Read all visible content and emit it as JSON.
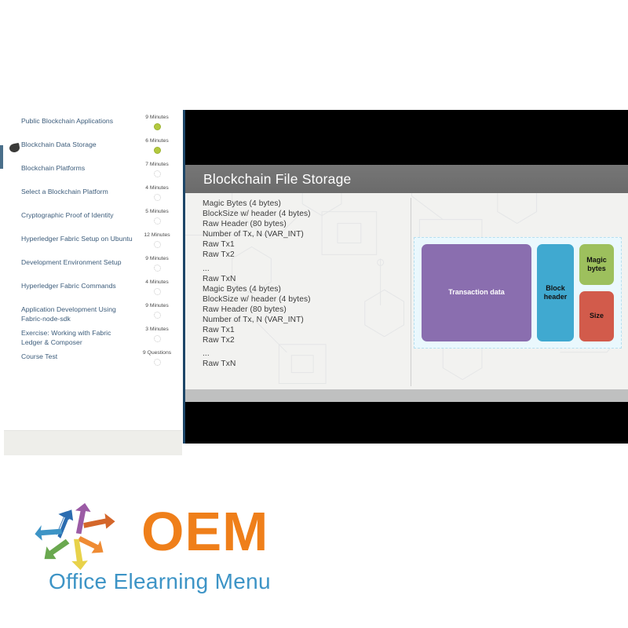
{
  "player": {
    "sidebar": {
      "lessons": [
        {
          "title": "Public Blockchain Applications",
          "duration": "9 Minutes",
          "status": "done"
        },
        {
          "title": "Blockchain Data Storage",
          "duration": "6 Minutes",
          "status": "done",
          "active": true
        },
        {
          "title": "Blockchain Platforms",
          "duration": "7 Minutes",
          "status": "todo"
        },
        {
          "title": "Select a Blockchain Platform",
          "duration": "4 Minutes",
          "status": "todo"
        },
        {
          "title": "Cryptographic Proof of Identity",
          "duration": "5 Minutes",
          "status": "todo"
        },
        {
          "title": "Hyperledger Fabric Setup on Ubuntu",
          "duration": "12 Minutes",
          "status": "todo"
        },
        {
          "title": "Development Environment Setup",
          "duration": "9 Minutes",
          "status": "todo"
        },
        {
          "title": "Hyperledger Fabric Commands",
          "duration": "4 Minutes",
          "status": "todo"
        },
        {
          "title": "Application Development Using Fabric-node-sdk",
          "duration": "9 Minutes",
          "status": "todo"
        },
        {
          "title": "Exercise: Working with Fabric Ledger & Composer",
          "duration": "3 Minutes",
          "status": "todo"
        },
        {
          "title": "Course Test",
          "duration": "9 Questions",
          "status": "todo"
        }
      ]
    },
    "slide": {
      "title": "Blockchain File Storage",
      "code_lines": [
        "Magic Bytes (4 bytes)",
        "BlockSize w/ header (4 bytes)",
        "Raw Header (80 bytes)",
        "Number of Tx, N (VAR_INT)",
        "Raw Tx1",
        "Raw Tx2",
        "",
        "...",
        "Raw TxN",
        "Magic Bytes (4 bytes)",
        "BlockSize w/ header (4 bytes)",
        "Raw Header (80 bytes)",
        "Number of Tx, N (VAR_INT)",
        "Raw Tx1",
        "Raw Tx2",
        "",
        "...",
        "Raw TxN"
      ],
      "diagram": {
        "transaction_data": "Transaction data",
        "block_header": "Block header",
        "magic_bytes": "Magic bytes",
        "size": "Size",
        "colors": {
          "transaction_data": "#8a6eaf",
          "block_header": "#40a9d0",
          "magic_bytes": "#9dc05d",
          "size": "#d25b4b",
          "panel_background": "#eaf8fd"
        }
      }
    }
  },
  "logo": {
    "wordmark": "OEM",
    "tagline": "Office Elearning Menu",
    "colors": {
      "wordmark": "#ef7f1a",
      "tagline": "#3d94c6"
    },
    "arrows": [
      {
        "name": "arrow-up-left-blue",
        "color": "#2b6cb0"
      },
      {
        "name": "arrow-up-purple",
        "color": "#9b5ba5"
      },
      {
        "name": "arrow-right-orange",
        "color": "#d4662a"
      },
      {
        "name": "arrow-down-right-orange",
        "color": "#ef8b33"
      },
      {
        "name": "arrow-down-yellow",
        "color": "#e8d24a"
      },
      {
        "name": "arrow-down-left-green",
        "color": "#6aa84f"
      },
      {
        "name": "arrow-left-lightblue",
        "color": "#3d94c6"
      },
      {
        "name": "arrow-up-left-darkblue",
        "color": "#2b6cb0"
      }
    ]
  }
}
